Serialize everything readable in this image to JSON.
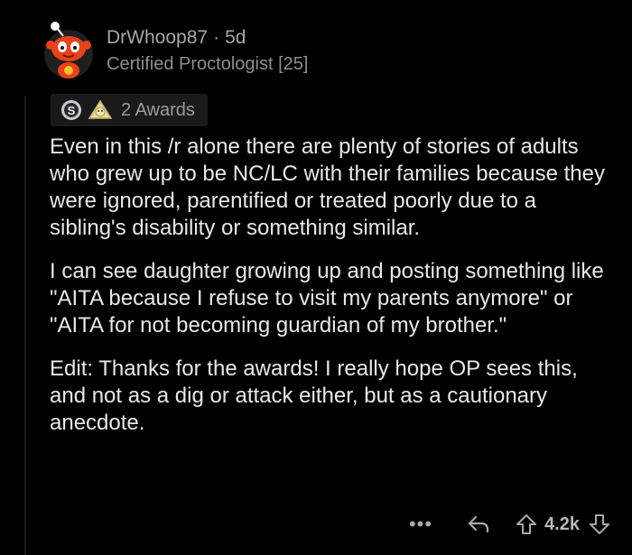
{
  "comment": {
    "username": "DrWhoop87",
    "separator": "·",
    "age": "5d",
    "flair": "Certified Proctologist [25]",
    "awards_label": "2 Awards",
    "paragraphs": [
      "Even in this /r alone there are plenty of stories of adults who grew up to be NC/LC with their families because they were ignored, parentified or treated poorly due to a sibling's disability or something similar.",
      "I can see daughter growing up and posting something like \"AITA because I refuse to visit my parents anymore\" or \"AITA for not becoming guardian of my brother.\"",
      "Edit: Thanks for the awards! I really hope OP sees this, and not as a dig or attack either,  but as a cautionary anecdote."
    ]
  },
  "actions": {
    "more": "•••",
    "score": "4.2k"
  },
  "icons": {
    "avatar": "snoo-avatar-icon",
    "award1": "silver-award-icon",
    "award2": "helpful-award-icon",
    "more": "more-options-icon",
    "reply": "reply-arrow-icon",
    "upvote": "upvote-arrow-icon",
    "downvote": "downvote-arrow-icon"
  },
  "colors": {
    "background": "#000000",
    "text": "#e6e8ea",
    "meta": "#a6a8aa",
    "avatar_orange": "#e8421a"
  }
}
